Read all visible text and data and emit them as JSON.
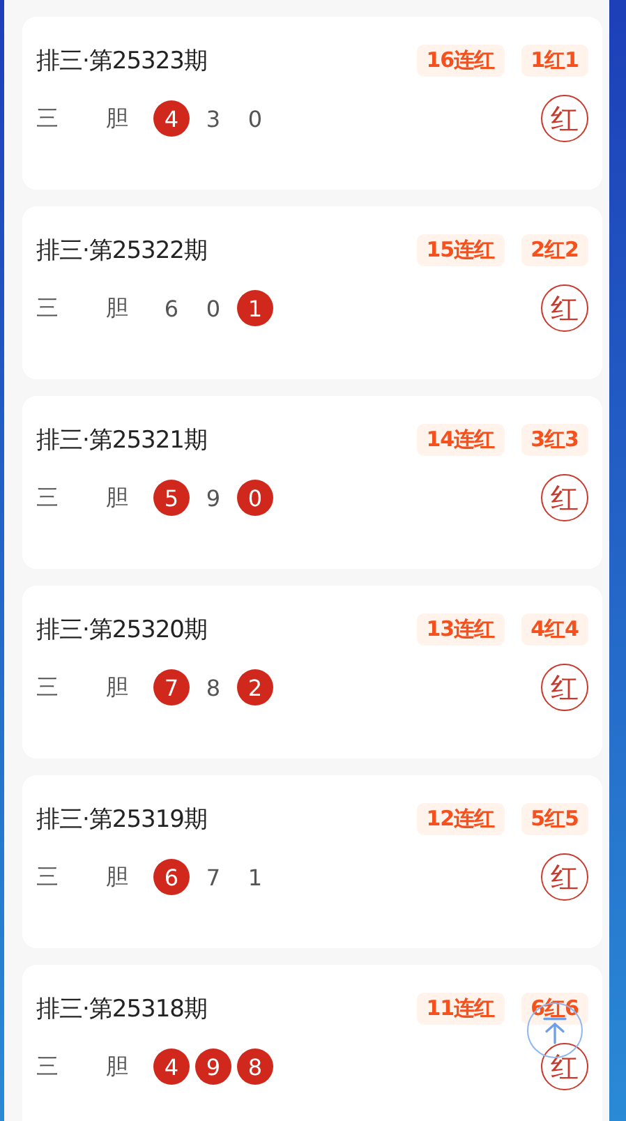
{
  "draws": [
    {
      "title": "排三·第25323期",
      "streak": "16连红",
      "hits": "1红1",
      "label_1": "三",
      "label_2": "胆",
      "digits": [
        {
          "value": "4",
          "hit": true
        },
        {
          "value": "3",
          "hit": false
        },
        {
          "value": "0",
          "hit": false
        }
      ],
      "result": "红"
    },
    {
      "title": "排三·第25322期",
      "streak": "15连红",
      "hits": "2红2",
      "label_1": "三",
      "label_2": "胆",
      "digits": [
        {
          "value": "6",
          "hit": false
        },
        {
          "value": "0",
          "hit": false
        },
        {
          "value": "1",
          "hit": true
        }
      ],
      "result": "红"
    },
    {
      "title": "排三·第25321期",
      "streak": "14连红",
      "hits": "3红3",
      "label_1": "三",
      "label_2": "胆",
      "digits": [
        {
          "value": "5",
          "hit": true
        },
        {
          "value": "9",
          "hit": false
        },
        {
          "value": "0",
          "hit": true
        }
      ],
      "result": "红"
    },
    {
      "title": "排三·第25320期",
      "streak": "13连红",
      "hits": "4红4",
      "label_1": "三",
      "label_2": "胆",
      "digits": [
        {
          "value": "7",
          "hit": true
        },
        {
          "value": "8",
          "hit": false
        },
        {
          "value": "2",
          "hit": true
        }
      ],
      "result": "红"
    },
    {
      "title": "排三·第25319期",
      "streak": "12连红",
      "hits": "5红5",
      "label_1": "三",
      "label_2": "胆",
      "digits": [
        {
          "value": "6",
          "hit": true
        },
        {
          "value": "7",
          "hit": false
        },
        {
          "value": "1",
          "hit": false
        }
      ],
      "result": "红"
    },
    {
      "title": "排三·第25318期",
      "streak": "11连红",
      "hits": "6红6",
      "label_1": "三",
      "label_2": "胆",
      "digits": [
        {
          "value": "4",
          "hit": true
        },
        {
          "value": "9",
          "hit": true
        },
        {
          "value": "8",
          "hit": true
        }
      ],
      "result": "红"
    }
  ]
}
